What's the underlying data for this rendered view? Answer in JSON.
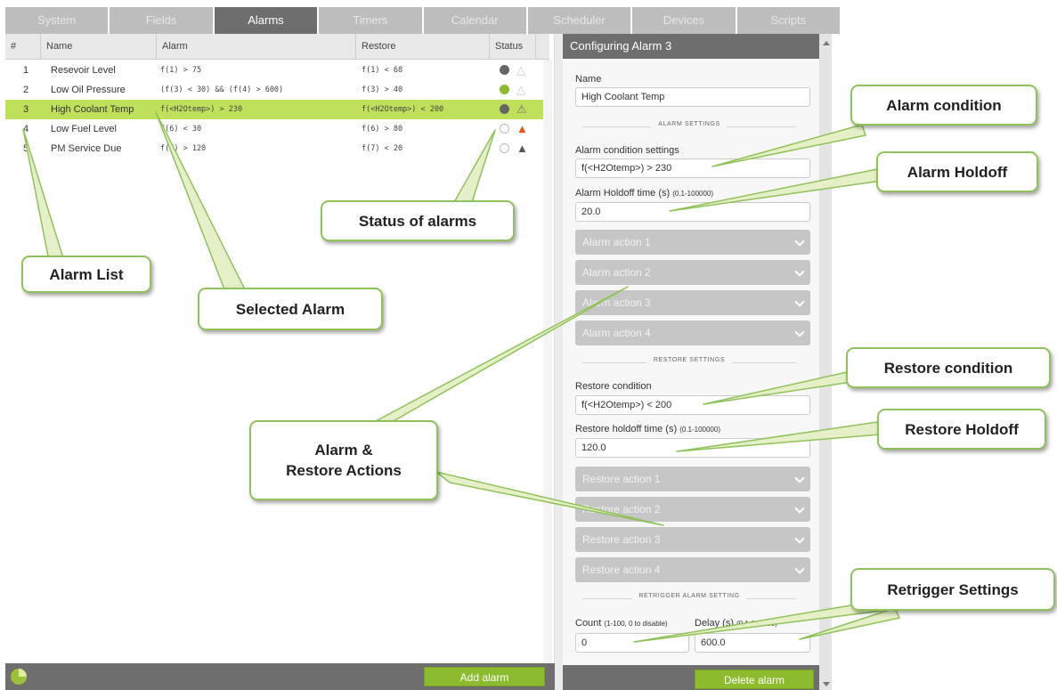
{
  "tabs": [
    "System",
    "Fields",
    "Alarms",
    "Timers",
    "Calendar",
    "Scheduler",
    "Devices",
    "Scripts"
  ],
  "active_tab": "Alarms",
  "table": {
    "headers": [
      "#",
      "Name",
      "Alarm",
      "Restore",
      "Status"
    ],
    "rows": [
      {
        "num": "1",
        "name": "Resevoir Level",
        "alarm": "f(1) > 75",
        "restore": "f(1) < 68"
      },
      {
        "num": "2",
        "name": "Low Oil Pressure",
        "alarm": "(f(3) < 30) && (f(4) > 600)",
        "restore": "f(3) > 40"
      },
      {
        "num": "3",
        "name": "High Coolant Temp",
        "alarm": "f(<H2Otemp>) > 230",
        "restore": "f(<H2Otemp>) < 200"
      },
      {
        "num": "4",
        "name": "Low Fuel Level",
        "alarm": "f(6) < 30",
        "restore": "f(6) > 80"
      },
      {
        "num": "5",
        "name": "PM Service Due",
        "alarm": "f(7) > 120",
        "restore": "f(7) < 20"
      }
    ],
    "selected_row": 3
  },
  "add_alarm_label": "Add alarm",
  "panel": {
    "title": "Configuring Alarm 3",
    "name_label": "Name",
    "name_value": "High Coolant Temp",
    "alarm_settings_header": "ALARM SETTINGS",
    "alarm_condition_label": "Alarm condition settings",
    "alarm_condition_value": "f(<H2Otemp>) > 230",
    "alarm_holdoff_label": "Alarm Holdoff time (s)",
    "alarm_holdoff_range": "(0.1-100000)",
    "alarm_holdoff_value": "20.0",
    "alarm_actions": [
      "Alarm action 1",
      "Alarm action 2",
      "Alarm action 3",
      "Alarm action 4"
    ],
    "restore_settings_header": "RESTORE SETTINGS",
    "restore_condition_label": "Restore condition",
    "restore_condition_value": "f(<H2Otemp>) < 200",
    "restore_holdoff_label": "Restore holdoff time (s)",
    "restore_holdoff_range": "(0.1-100000)",
    "restore_holdoff_value": "120.0",
    "restore_actions": [
      "Restore action 1",
      "Restore action 2",
      "Restore action 3",
      "Restore action 4"
    ],
    "retrigger_header": "RETRIGGER ALARM SETTING",
    "count_label": "Count",
    "count_range": "(1-100, 0 to disable)",
    "delay_label": "Delay (s)",
    "delay_range": "(0.1-100000)",
    "count_value": "0",
    "delay_value": "600.0",
    "delete_label": "Delete alarm"
  },
  "callouts": {
    "alarm_list": "Alarm List",
    "selected_alarm": "Selected Alarm",
    "status_of_alarms": "Status of alarms",
    "alarm_restore_actions_1": "Alarm &",
    "alarm_restore_actions_2": "Restore Actions",
    "alarm_condition": "Alarm condition",
    "alarm_holdoff": "Alarm Holdoff",
    "restore_condition": "Restore condition",
    "restore_holdoff": "Restore Holdoff",
    "retrigger_settings": "Retrigger Settings"
  },
  "colors": {
    "accent_green": "#8dbb2e",
    "selected_row": "#bfe05a",
    "callout_border": "#8fc25a",
    "header_dark": "#6e6e6e",
    "status_warning_orange": "#e8541c"
  }
}
